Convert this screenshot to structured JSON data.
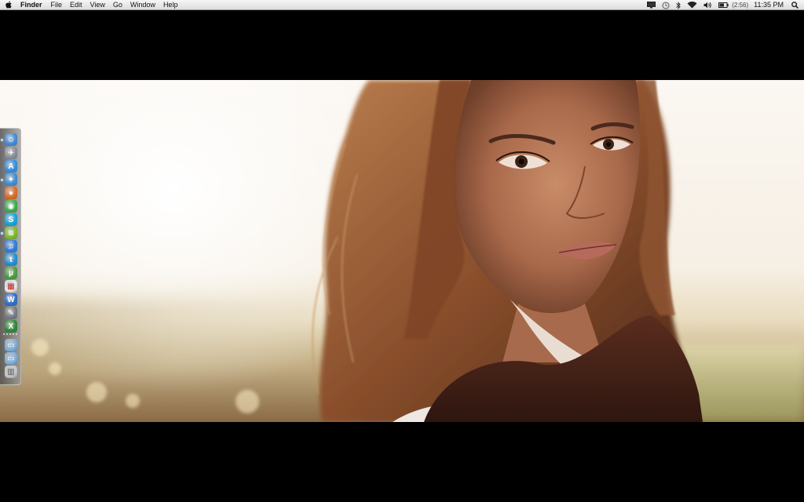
{
  "menubar": {
    "app_name": "Finder",
    "items": [
      "File",
      "Edit",
      "View",
      "Go",
      "Window",
      "Help"
    ],
    "status": {
      "battery_time": "(2:56)",
      "clock": "11:35 PM",
      "icons": [
        "display-icon",
        "time-machine-icon",
        "bluetooth-icon",
        "wifi-icon",
        "volume-icon",
        "battery-icon",
        "spotlight-icon"
      ]
    }
  },
  "wallpaper": {
    "description_icon": "portrait-photo"
  },
  "dock": {
    "position": "left",
    "items": [
      {
        "name": "finder",
        "icon": "finder-icon",
        "running": true,
        "color": "#3f8ae0"
      },
      {
        "name": "launchpad",
        "icon": "launchpad-icon",
        "running": false,
        "color": "#8a8f99"
      },
      {
        "name": "app-store",
        "icon": "app-store-icon",
        "running": false,
        "color": "#2f8fe8"
      },
      {
        "name": "safari",
        "icon": "safari-icon",
        "running": true,
        "color": "#3a8fd9"
      },
      {
        "name": "firefox",
        "icon": "firefox-icon",
        "running": false,
        "color": "#e36a1f"
      },
      {
        "name": "chrome",
        "icon": "chrome-icon",
        "running": false,
        "color": "#3cae4f"
      },
      {
        "name": "skype",
        "icon": "skype-icon",
        "running": false,
        "color": "#12a5e6"
      },
      {
        "name": "spotify",
        "icon": "spotify-icon",
        "running": true,
        "color": "#7cbf28"
      },
      {
        "name": "itunes",
        "icon": "itunes-icon",
        "running": false,
        "color": "#2a7de0"
      },
      {
        "name": "twitter",
        "icon": "twitter-icon",
        "running": false,
        "color": "#1d8fd6"
      },
      {
        "name": "utorrent",
        "icon": "utorrent-icon",
        "running": false,
        "color": "#46a13d"
      },
      {
        "name": "calendar",
        "icon": "calendar-icon",
        "running": false,
        "color": "#e8e8e8"
      },
      {
        "name": "word",
        "icon": "word-icon",
        "running": false,
        "color": "#2a6fd1"
      },
      {
        "name": "preview",
        "icon": "preview-icon",
        "running": false,
        "color": "#777c85"
      },
      {
        "name": "excel",
        "icon": "excel-icon",
        "running": false,
        "color": "#2c8a3c"
      },
      {
        "name": "applications-folder",
        "icon": "folder-icon",
        "running": false,
        "color": "#7fb1e0"
      },
      {
        "name": "documents-folder",
        "icon": "folder-icon",
        "running": false,
        "color": "#7fb1e0"
      },
      {
        "name": "trash",
        "icon": "trash-icon",
        "running": false,
        "color": "#c6c9cc"
      }
    ]
  }
}
